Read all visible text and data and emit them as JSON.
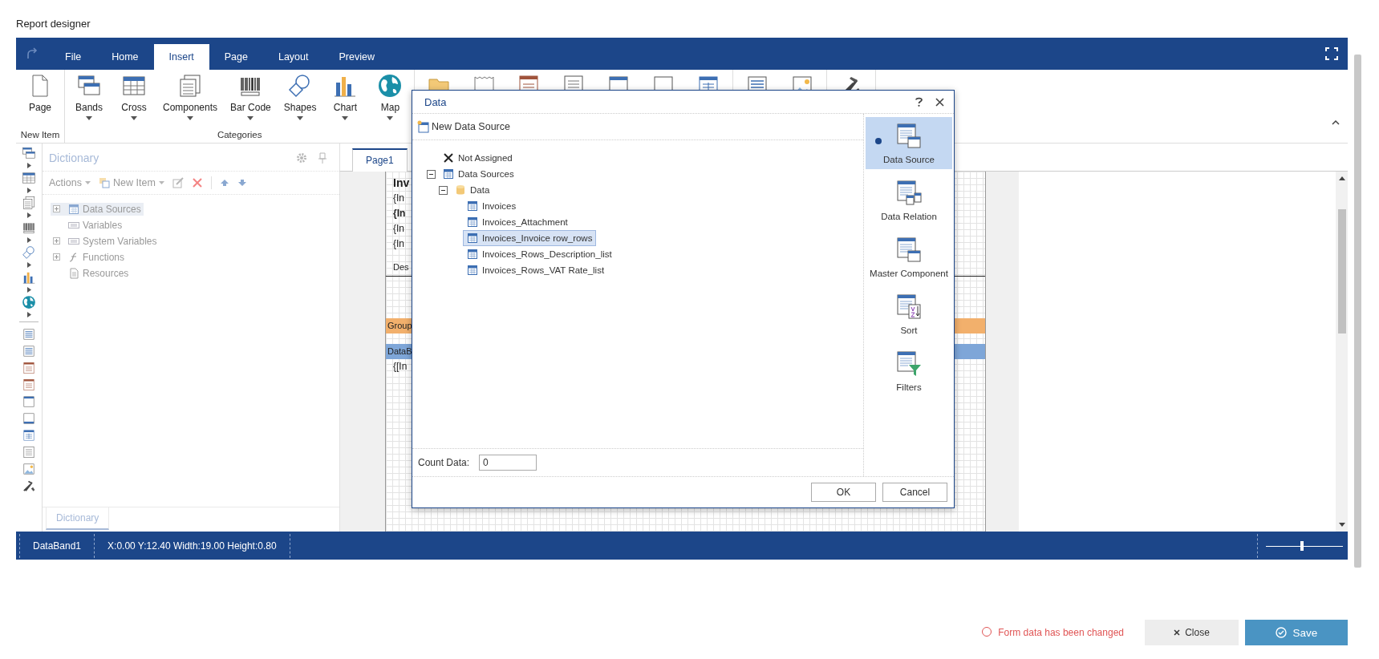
{
  "page_title": "Report designer",
  "tabs": [
    {
      "label": "File",
      "selected": false
    },
    {
      "label": "Home",
      "selected": false
    },
    {
      "label": "Insert",
      "selected": true
    },
    {
      "label": "Page",
      "selected": false
    },
    {
      "label": "Layout",
      "selected": false
    },
    {
      "label": "Preview",
      "selected": false
    }
  ],
  "ribbon": {
    "groups": [
      {
        "label": "New Item",
        "items": [
          {
            "label": "Page",
            "kind": "page",
            "dropdown": false
          }
        ]
      },
      {
        "label": "Categories",
        "items": [
          {
            "label": "Bands",
            "kind": "bands",
            "dropdown": true
          },
          {
            "label": "Cross",
            "kind": "cross",
            "dropdown": true
          },
          {
            "label": "Components",
            "kind": "components",
            "dropdown": true
          },
          {
            "label": "Bar Code",
            "kind": "barcode",
            "dropdown": true
          },
          {
            "label": "Shapes",
            "kind": "shapes",
            "dropdown": true
          },
          {
            "label": "Chart",
            "kind": "chart",
            "dropdown": true
          },
          {
            "label": "Map",
            "kind": "map",
            "dropdown": true
          }
        ]
      },
      {
        "items": [
          {
            "kind": "header"
          },
          {
            "kind": "zigzag"
          },
          {
            "kind": "textred"
          },
          {
            "kind": "text"
          },
          {
            "kind": "paneltop"
          },
          {
            "kind": "panel"
          },
          {
            "kind": "table"
          }
        ]
      },
      {
        "items": [
          {
            "kind": "lines"
          },
          {
            "kind": "image"
          }
        ]
      },
      {
        "items": [
          {
            "kind": "tools"
          }
        ]
      }
    ]
  },
  "toolbox": [
    {
      "kind": "bands",
      "expandable": true
    },
    {
      "kind": "cross",
      "expandable": true
    },
    {
      "kind": "components",
      "expandable": true
    },
    {
      "kind": "barcode",
      "expandable": true
    },
    {
      "kind": "shapes",
      "expandable": true
    },
    {
      "kind": "chart",
      "expandable": true
    },
    {
      "kind": "map",
      "expandable": true
    },
    {
      "kind": "lines",
      "expandable": false
    },
    {
      "kind": "lines",
      "expandable": false
    },
    {
      "kind": "textred",
      "expandable": false
    },
    {
      "kind": "textred",
      "expandable": false
    },
    {
      "kind": "paneltop",
      "expandable": false
    },
    {
      "kind": "panelbottom",
      "expandable": false
    },
    {
      "kind": "table",
      "expandable": false
    },
    {
      "kind": "text",
      "expandable": false
    },
    {
      "kind": "image",
      "expandable": false
    },
    {
      "kind": "tools",
      "expandable": false
    }
  ],
  "dictionary": {
    "title": "Dictionary",
    "disabled": true,
    "toolbar": [
      {
        "label": "Actions"
      },
      {
        "label": "New Item"
      }
    ],
    "tree": [
      {
        "label": "Data Sources",
        "kind": "table",
        "expandable": true,
        "selected": true
      },
      {
        "label": "Variables",
        "kind": "var",
        "expandable": false,
        "selected": false
      },
      {
        "label": "System Variables",
        "kind": "sysvar",
        "expandable": true,
        "selected": false
      },
      {
        "label": "Functions",
        "kind": "function",
        "expandable": true,
        "selected": false
      },
      {
        "label": "Resources",
        "kind": "resource",
        "expandable": false,
        "selected": false
      }
    ],
    "bottom_tab": "Dictionary"
  },
  "designer_tab": "Page1",
  "page_fragments": [
    {
      "text": "Inv",
      "kind": "title"
    },
    {
      "text": "{In",
      "kind": "field"
    },
    {
      "text": "{In",
      "kind": "boldfield"
    },
    {
      "text": "{In",
      "kind": "field"
    },
    {
      "text": "{In",
      "kind": "field"
    },
    {
      "text": "Des",
      "kind": "header"
    },
    {
      "text": "Group",
      "kind": "groupband"
    },
    {
      "text": "DataB",
      "kind": "databand"
    },
    {
      "text": "{[In",
      "kind": "field"
    }
  ],
  "dialog": {
    "title": "Data",
    "new_source": "New Data Source",
    "tree": [
      {
        "label": "Not Assigned",
        "kind": "none",
        "selected": false
      },
      {
        "label": "Data Sources",
        "kind": "sources",
        "selected": false,
        "expanded": true,
        "children": [
          {
            "label": "Data",
            "kind": "database",
            "selected": false,
            "expanded": true,
            "children": [
              {
                "label": "Invoices",
                "kind": "table",
                "selected": false
              },
              {
                "label": "Invoices_Attachment",
                "kind": "table",
                "selected": false
              },
              {
                "label": "Invoices_Invoice row_rows",
                "kind": "table",
                "selected": true
              },
              {
                "label": "Invoices_Rows_Description_list",
                "kind": "table",
                "selected": false
              },
              {
                "label": "Invoices_Rows_VAT Rate_list",
                "kind": "table",
                "selected": false
              }
            ]
          }
        ]
      }
    ],
    "count_label": "Count Data:",
    "count_value": "0",
    "sections": [
      {
        "label": "Data Source",
        "kind": "datasource",
        "selected": true
      },
      {
        "label": "Data Relation",
        "kind": "relation",
        "selected": false
      },
      {
        "label": "Master Component",
        "kind": "master",
        "selected": false
      },
      {
        "label": "Sort",
        "kind": "sort",
        "selected": false
      },
      {
        "label": "Filters",
        "kind": "filter",
        "selected": false
      }
    ],
    "buttons": [
      "OK",
      "Cancel"
    ]
  },
  "status_bar": {
    "component": "DataBand1",
    "position": "X:0.00 Y:12.40 Width:19.00 Height:0.80",
    "zoom": {
      "level": 0.47
    }
  },
  "footer": {
    "message": "Form data has been changed",
    "close": "Close",
    "save": "Save"
  }
}
